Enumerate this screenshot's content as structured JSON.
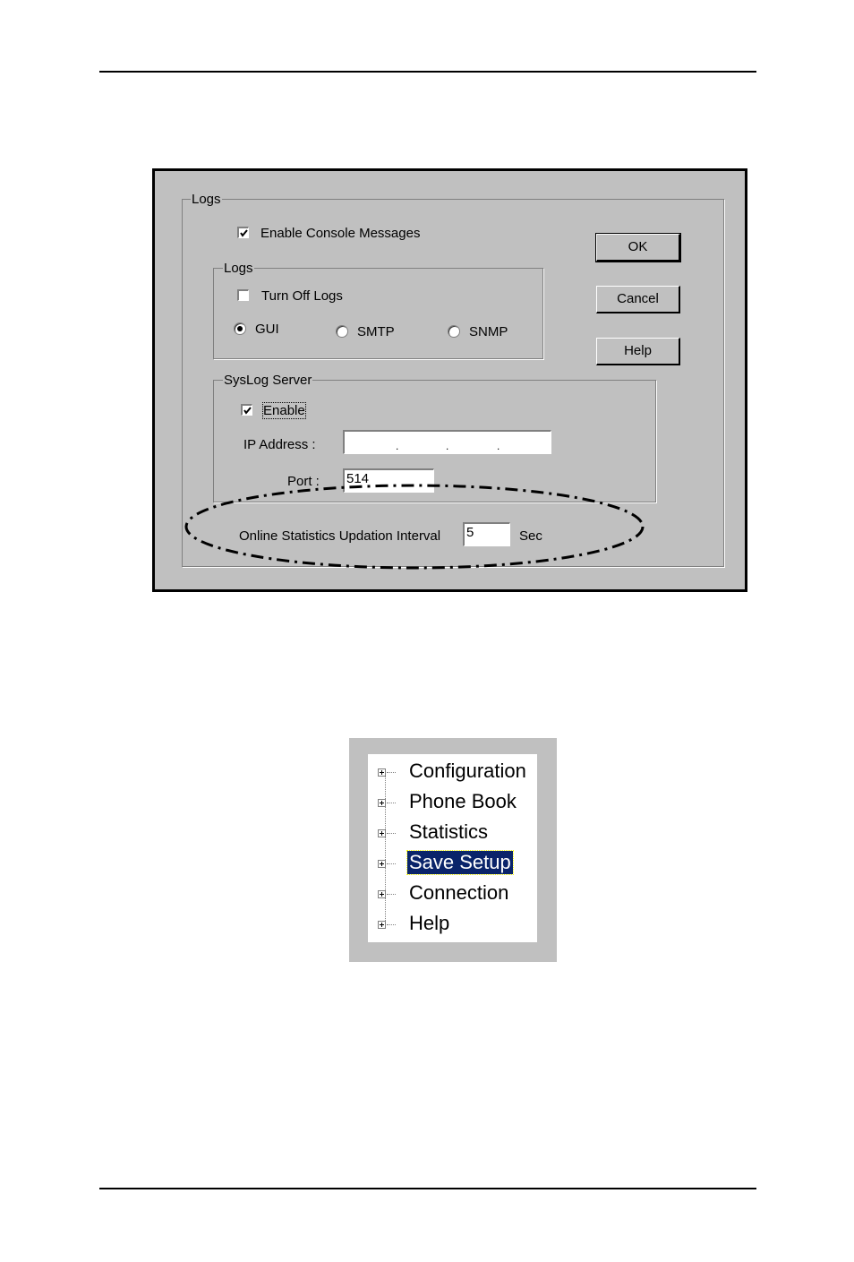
{
  "dialog": {
    "outer_group": "Logs",
    "enable_console": {
      "label": "Enable Console Messages",
      "checked": true
    },
    "logs_group": {
      "title": "Logs",
      "turn_off": {
        "label": "Turn Off Logs",
        "checked": false
      },
      "radios": [
        {
          "label": "GUI",
          "selected": true
        },
        {
          "label": "SMTP",
          "selected": false
        },
        {
          "label": "SNMP",
          "selected": false
        }
      ]
    },
    "syslog": {
      "title": "SysLog Server",
      "enable": {
        "label": "Enable",
        "checked": true
      },
      "ip_label": "IP Address :",
      "ip_value": "",
      "port_label": "Port :",
      "port_value": "514"
    },
    "stats": {
      "label": "Online Statistics Updation Interval",
      "value": "5",
      "unit": "Sec"
    },
    "buttons": {
      "ok": "OK",
      "cancel": "Cancel",
      "help": "Help"
    }
  },
  "tree": {
    "items": [
      {
        "label": "Configuration",
        "selected": false
      },
      {
        "label": "Phone Book",
        "selected": false
      },
      {
        "label": "Statistics",
        "selected": false
      },
      {
        "label": "Save Setup",
        "selected": true
      },
      {
        "label": "Connection",
        "selected": false
      },
      {
        "label": "Help",
        "selected": false
      }
    ]
  }
}
